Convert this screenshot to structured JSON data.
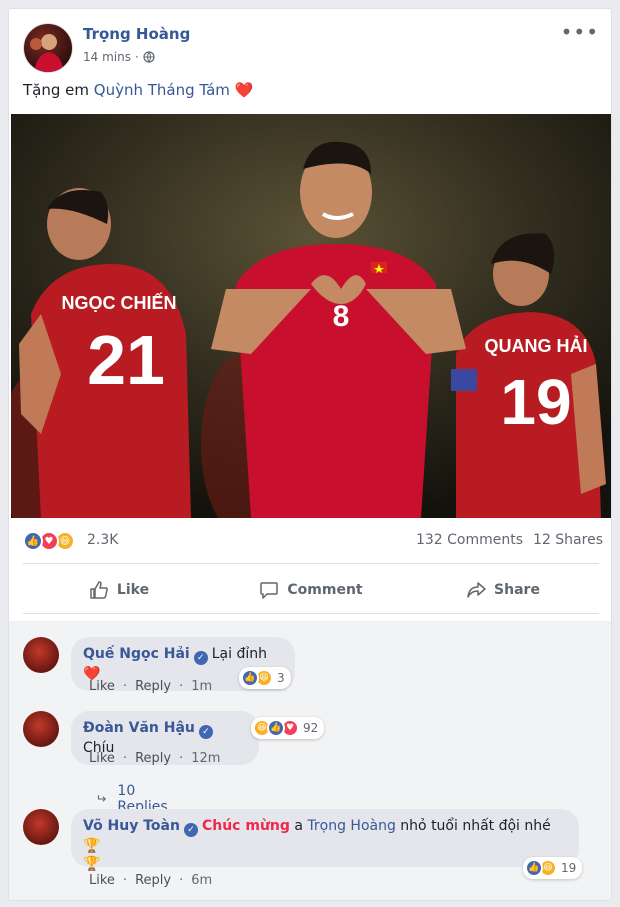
{
  "post": {
    "author": "Trọng Hoàng",
    "time": "14 mins",
    "text_prefix": "Tặng em ",
    "mention": "Quỳnh Tháng Tám",
    "heart": "❤️",
    "more": "•••"
  },
  "photo": {
    "jersey_left_name": "NGỌC CHIẾN",
    "jersey_left_number": "21",
    "jersey_center_number": "8",
    "jersey_right_name": "QUANG HẢI",
    "jersey_right_number": "19"
  },
  "stats": {
    "reactions": "2.3K",
    "comments": "132 Comments",
    "shares": "12 Shares"
  },
  "actions": {
    "like": "Like",
    "comment": "Comment",
    "share": "Share"
  },
  "comments": [
    {
      "name": "Quế Ngọc Hải",
      "text": "Lại đỉnh",
      "emoji": "❤️",
      "reaction_count": "3",
      "like": "Like",
      "reply": "Reply",
      "time": "1m"
    },
    {
      "name": "Đoàn Văn Hậu",
      "text": "Chíu",
      "reaction_count": "92",
      "like": "Like",
      "reply": "Reply",
      "time": "12m",
      "replies_label": "10 Replies"
    },
    {
      "name": "Võ Huy Toàn",
      "text_highlight": "Chúc mừng",
      "text_a": " a ",
      "mention": "Trọng Hoàng",
      "text_rest": " nhỏ tuổi nhất đội nhé",
      "trophy": "🏆",
      "reaction_count": "19",
      "like": "Like",
      "reply": "Reply",
      "time": "6m"
    }
  ],
  "colors": {
    "link": "#365899",
    "like_blue": "#4267b2",
    "love_red": "#f33e58",
    "haha_yellow": "#f7b125",
    "jersey_red": "#c8102e"
  }
}
